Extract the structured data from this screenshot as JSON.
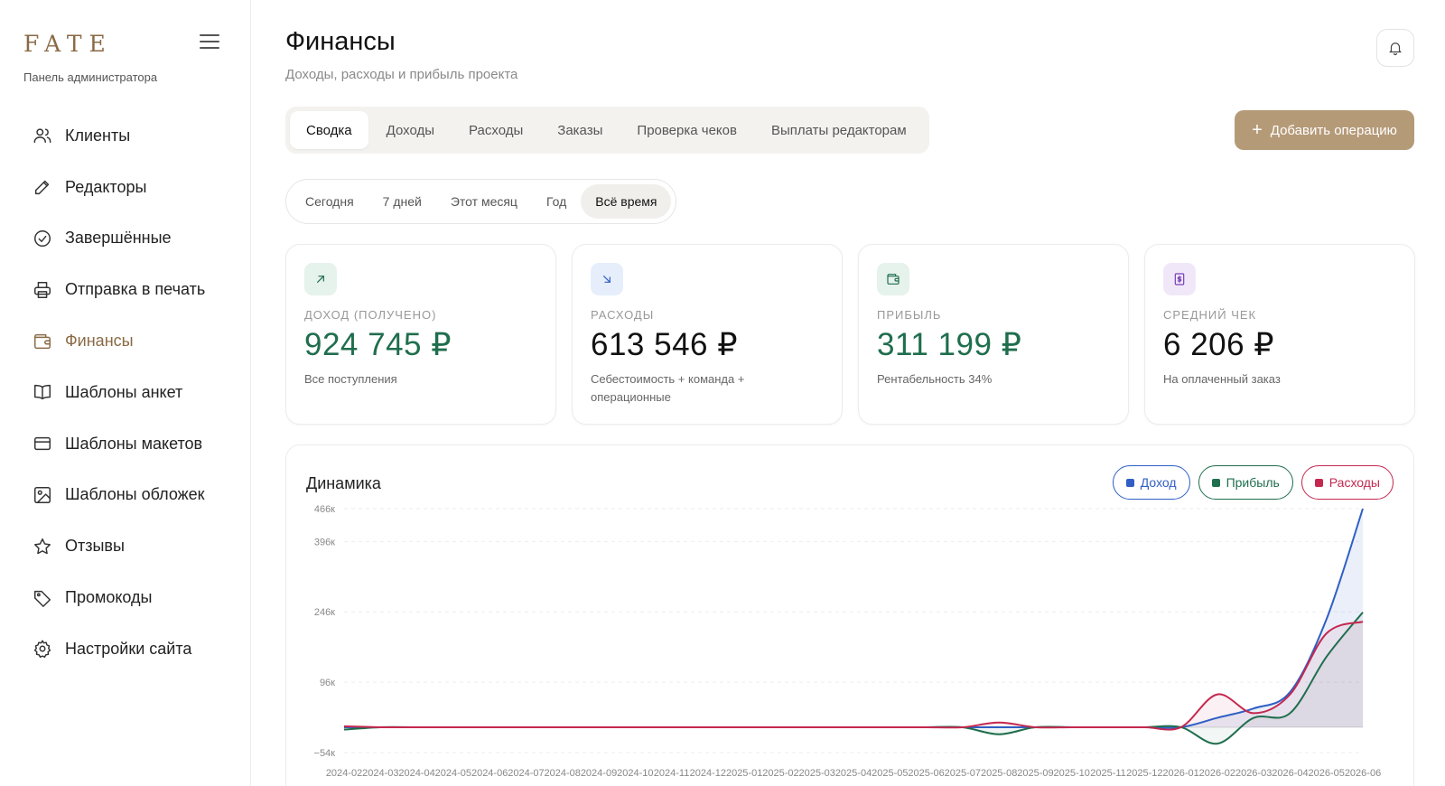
{
  "sidebar": {
    "brand": "FATE",
    "subtitle": "Панель администратора",
    "items": [
      {
        "label": "Клиенты",
        "icon": "users-icon"
      },
      {
        "label": "Редакторы",
        "icon": "pencil-icon"
      },
      {
        "label": "Завершённые",
        "icon": "check-circle-icon"
      },
      {
        "label": "Отправка в печать",
        "icon": "printer-icon"
      },
      {
        "label": "Финансы",
        "icon": "wallet-icon",
        "active": true
      },
      {
        "label": "Шаблоны анкет",
        "icon": "book-icon"
      },
      {
        "label": "Шаблоны макетов",
        "icon": "card-icon"
      },
      {
        "label": "Шаблоны обложек",
        "icon": "image-icon"
      },
      {
        "label": "Отзывы",
        "icon": "star-icon"
      },
      {
        "label": "Промокоды",
        "icon": "tag-icon"
      },
      {
        "label": "Настройки сайта",
        "icon": "gear-icon"
      }
    ]
  },
  "header": {
    "title": "Финансы",
    "subtitle": "Доходы, расходы и прибыль проекта"
  },
  "tabs": [
    "Сводка",
    "Доходы",
    "Расходы",
    "Заказы",
    "Проверка чеков",
    "Выплаты редакторам"
  ],
  "active_tab": "Сводка",
  "add_button": "Добавить операцию",
  "periods": [
    "Сегодня",
    "7 дней",
    "Этот месяц",
    "Год",
    "Всё время"
  ],
  "active_period": "Всё время",
  "cards": [
    {
      "label": "ДОХОД (ПОЛУЧЕНО)",
      "value": "924 745 ₽",
      "desc": "Все поступления",
      "icon": "arrow-up-right-icon",
      "color": "#1f6e4d",
      "bg": "#e6f2ec"
    },
    {
      "label": "РАСХОДЫ",
      "value": "613 546 ₽",
      "desc": "Себестоимость + команда + операционные",
      "icon": "arrow-down-right-icon",
      "color": "#2f5fc4",
      "bg": "#e6eefb"
    },
    {
      "label": "ПРИБЫЛЬ",
      "value": "311 199 ₽",
      "desc": "Рентабельность 34%",
      "icon": "wallet-icon",
      "color": "#1f6e4d",
      "bg": "#e6f2ec"
    },
    {
      "label": "СРЕДНИЙ ЧЕК",
      "value": "6 206 ₽",
      "desc": "На оплаченный заказ",
      "icon": "receipt-icon",
      "color": "#7b3fb8",
      "bg": "#f0e8f8"
    }
  ],
  "chart": {
    "title": "Динамика",
    "legend": [
      {
        "label": "Доход",
        "color": "#2f5fc4"
      },
      {
        "label": "Прибыль",
        "color": "#1f6e4d"
      },
      {
        "label": "Расходы",
        "color": "#c4284f"
      }
    ]
  },
  "chart_data": {
    "type": "line",
    "title": "Динамика",
    "yticks": [
      "466к",
      "396к",
      "246к",
      "96к",
      "−54к"
    ],
    "ytick_values": [
      466,
      396,
      246,
      96,
      -54
    ],
    "ylim": [
      -54,
      466
    ],
    "xlabels": [
      "2024-02",
      "2024-03",
      "2024-04",
      "2024-05",
      "2024-06",
      "2024-07",
      "2024-08",
      "2024-09",
      "2024-10",
      "2024-11",
      "2024-12",
      "2025-01",
      "2025-02",
      "2025-03",
      "2025-04",
      "2025-05",
      "2025-06",
      "2025-07",
      "2025-08",
      "2025-09",
      "2025-10",
      "2025-11",
      "2025-12",
      "2026-01",
      "2026-02",
      "2026-03",
      "2026-04",
      "2026-05",
      "2026-06"
    ],
    "series": [
      {
        "name": "Доход",
        "color": "#2f5fc4",
        "values": [
          0,
          0,
          0,
          0,
          0,
          0,
          0,
          0,
          0,
          0,
          0,
          0,
          0,
          0,
          0,
          0,
          0,
          0,
          0,
          0,
          0,
          0,
          0,
          0,
          20,
          40,
          75,
          230,
          466
        ]
      },
      {
        "name": "Прибыль",
        "color": "#1f6e4d",
        "values": [
          -5,
          0,
          0,
          0,
          0,
          0,
          0,
          0,
          0,
          0,
          0,
          0,
          0,
          0,
          0,
          0,
          0,
          0,
          -15,
          0,
          0,
          0,
          0,
          0,
          -35,
          20,
          30,
          150,
          245
        ]
      },
      {
        "name": "Расходы",
        "color": "#c4284f",
        "values": [
          2,
          0,
          0,
          0,
          0,
          0,
          0,
          0,
          0,
          0,
          0,
          0,
          0,
          0,
          0,
          0,
          0,
          0,
          10,
          0,
          0,
          0,
          0,
          0,
          70,
          30,
          70,
          200,
          225
        ]
      }
    ]
  }
}
